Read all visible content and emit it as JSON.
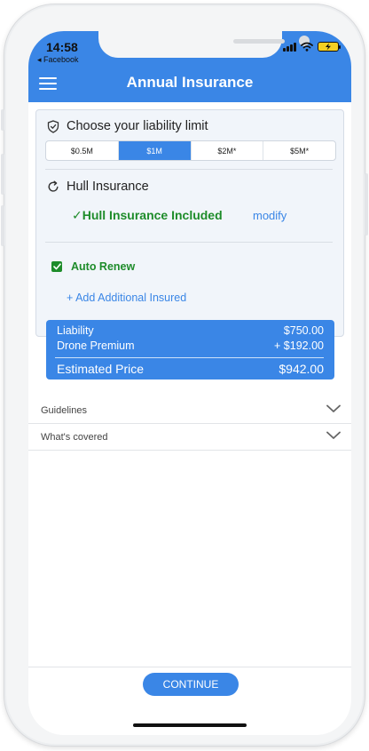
{
  "status_bar": {
    "time": "14:58",
    "back_app": "◂ Facebook"
  },
  "header": {
    "title": "Annual Insurance",
    "menu_icon": "hamburger-menu-icon"
  },
  "liability": {
    "title": "Choose your liability limit",
    "icon": "shield-icon",
    "options": [
      "$0.5M",
      "$1M",
      "$2M*",
      "$5M*"
    ],
    "selected": "$1M"
  },
  "hull": {
    "title": "Hull Insurance",
    "icon": "refresh-icon",
    "status": "✓Hull Insurance Included",
    "modify_label": "modify"
  },
  "auto_renew": {
    "label": "Auto Renew",
    "checked": true
  },
  "add_insured_label": "+ Add Additional Insured",
  "price_summary": {
    "lines": [
      {
        "label": "Liability",
        "value": "$750.00"
      },
      {
        "label": "Drone Premium",
        "value": "+ $192.00"
      }
    ],
    "total_label": "Estimated Price",
    "total_value": "$942.00"
  },
  "accordions": [
    {
      "label": "Guidelines"
    },
    {
      "label": "What's covered"
    }
  ],
  "continue_label": "CONTINUE",
  "colors": {
    "accent": "#3a86e6",
    "success": "#1e8c2a"
  }
}
